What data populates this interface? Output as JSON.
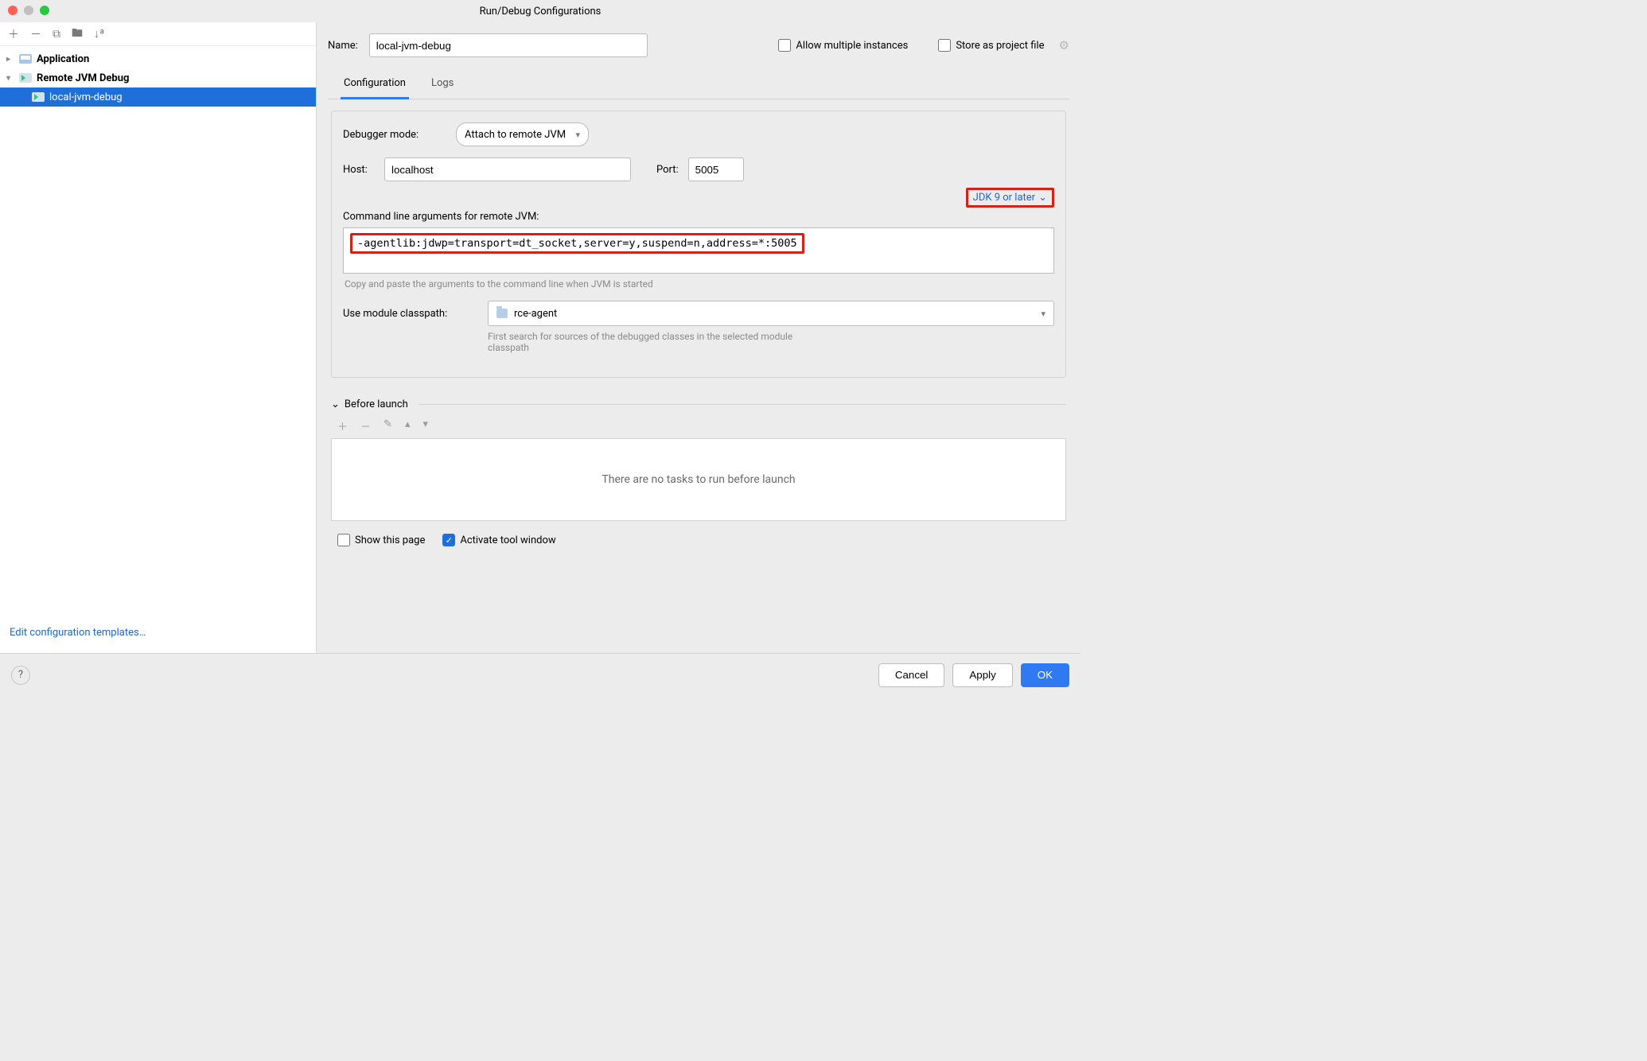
{
  "title": "Run/Debug Configurations",
  "sidebar": {
    "nodes": [
      {
        "label": "Application",
        "expanded": false
      },
      {
        "label": "Remote JVM Debug",
        "expanded": true,
        "children": [
          {
            "label": "local-jvm-debug",
            "selected": true
          }
        ]
      }
    ],
    "edit_templates": "Edit configuration templates…"
  },
  "name": {
    "label": "Name:",
    "value": "local-jvm-debug"
  },
  "allow_multiple": {
    "label": "Allow multiple instances",
    "checked": false
  },
  "store_project": {
    "label": "Store as project file",
    "checked": false
  },
  "tabs": [
    {
      "label": "Configuration",
      "active": true
    },
    {
      "label": "Logs",
      "active": false
    }
  ],
  "config": {
    "debugger_mode": {
      "label": "Debugger mode:",
      "value": "Attach to remote JVM"
    },
    "host": {
      "label": "Host:",
      "value": "localhost"
    },
    "port": {
      "label": "Port:",
      "value": "5005"
    },
    "cmd_label": "Command line arguments for remote JVM:",
    "cmd_value": "-agentlib:jdwp=transport=dt_socket,server=y,suspend=n,address=*:5005",
    "jdk_version": "JDK 9 or later",
    "copy_hint": "Copy and paste the arguments to the command line when JVM is started",
    "module": {
      "label": "Use module classpath:",
      "value": "rce-agent"
    },
    "module_hint": "First search for sources of the debugged classes in the selected module classpath"
  },
  "before_launch": {
    "label": "Before launch",
    "empty_text": "There are no tasks to run before launch",
    "show_page": {
      "label": "Show this page",
      "checked": false
    },
    "activate_tool": {
      "label": "Activate tool window",
      "checked": true
    }
  },
  "buttons": {
    "cancel": "Cancel",
    "apply": "Apply",
    "ok": "OK"
  }
}
